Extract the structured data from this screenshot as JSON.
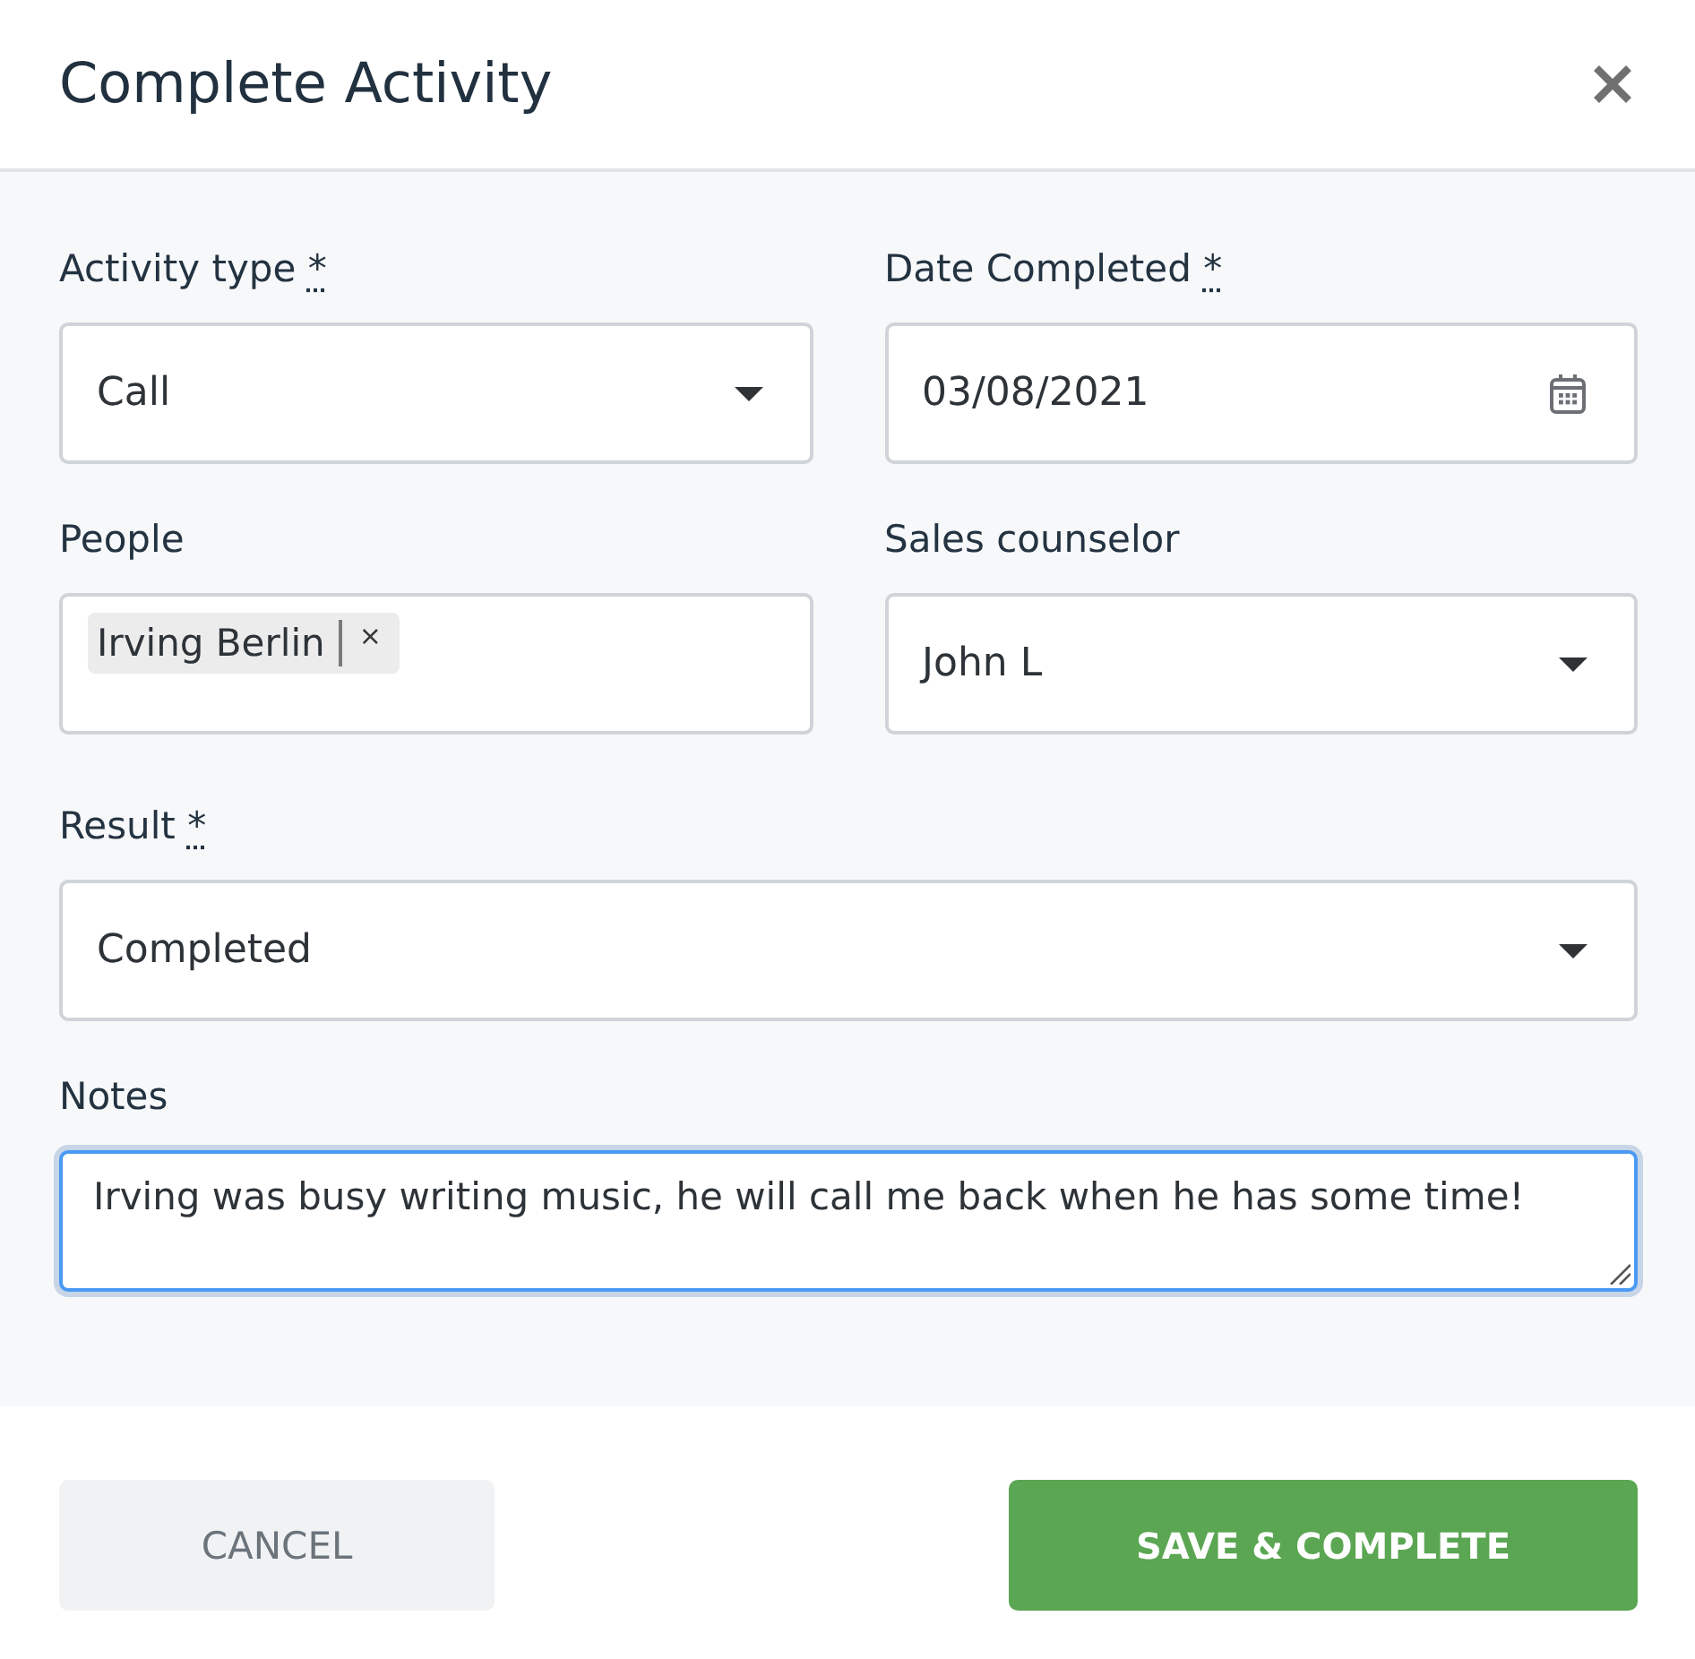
{
  "dialog": {
    "title": "Complete Activity"
  },
  "form": {
    "rows": [
      [
        {
          "kind": "select",
          "label": "Activity type",
          "required_mark": "*",
          "value": "Call",
          "focused": false
        },
        {
          "kind": "date",
          "label": "Date Completed",
          "required_mark": "*",
          "value": "03/08/2021",
          "focused": false
        }
      ],
      [
        {
          "kind": "tags",
          "label": "People",
          "tags": [
            {
              "label": "Irving Berlin",
              "remove": "×"
            }
          ],
          "focused": false
        },
        {
          "kind": "select",
          "label": "Sales counselor",
          "value": "John L",
          "focused": false
        }
      ],
      [
        {
          "kind": "select",
          "label": "Result",
          "required_mark": "*",
          "value": "Completed",
          "focused": false
        }
      ],
      [
        {
          "kind": "textarea",
          "label": "Notes",
          "value": "Irving was busy writing music, he will call me back when he has some time!",
          "focused": true
        }
      ]
    ]
  },
  "buttons": [
    {
      "kind": "cancel",
      "label": "CANCEL"
    },
    {
      "kind": "submit",
      "label": "SAVE & COMPLETE"
    }
  ]
}
